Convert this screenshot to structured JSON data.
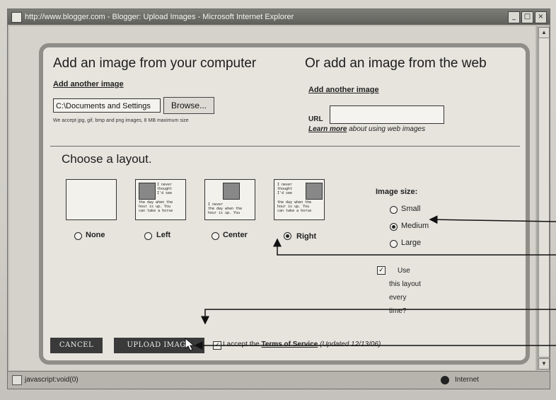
{
  "window": {
    "title": "http://www.blogger.com - Blogger: Upload Images - Microsoft Internet Explorer",
    "buttons": [
      "_",
      "□",
      "×"
    ]
  },
  "computer": {
    "heading": "Add an image from your computer",
    "add_link": "Add another image",
    "file_value": "C:\\Documents and Settings",
    "browse_label": "Browse...",
    "note": "We accept jpg, gif, bmp and png images, 8 MB maximum size"
  },
  "web": {
    "heading": "Or add an image from the web",
    "add_link": "Add another image",
    "url_label": "URL",
    "url_value": "",
    "learn_more": "Learn more",
    "learn_rest": " about using web images"
  },
  "layout": {
    "heading": "Choose a layout.",
    "options": [
      {
        "label": "None",
        "selected": false
      },
      {
        "label": "Left",
        "selected": false
      },
      {
        "label": "Center",
        "selected": false
      },
      {
        "label": "Right",
        "selected": true
      }
    ],
    "sample_lines": [
      "I never",
      "thought",
      "I'd see",
      "the day when the",
      "hour is up. You",
      "can take a horse"
    ]
  },
  "image_size": {
    "title": "Image size:",
    "options": [
      {
        "label": "Small",
        "selected": false
      },
      {
        "label": "Medium",
        "selected": true
      },
      {
        "label": "Large",
        "selected": false
      }
    ]
  },
  "use_layout": {
    "checked": true,
    "lines": [
      "Use",
      "this layout",
      "every",
      "time?"
    ]
  },
  "actions": {
    "cancel": "CANCEL",
    "upload": "UPLOAD IMAGE",
    "tos_checked": true,
    "tos_prefix": "I accept the ",
    "tos_link": "Terms of Service",
    "tos_updated": " (Updated 12/13/06)"
  },
  "status": {
    "text": "javascript:void(0)",
    "zone": "Internet"
  },
  "colors": {
    "button_bg": "#3a3a3a",
    "dialog_bg": "#e6e4dd",
    "dialog_border": "#8f8d87"
  }
}
